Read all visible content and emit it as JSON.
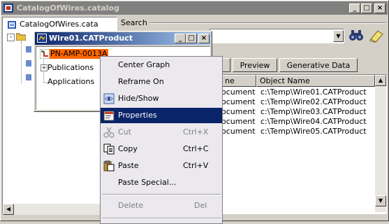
{
  "main_window": {
    "title": "CatalogOfWires.catalog"
  },
  "tree": {
    "root_label": "CatalogOfWires.cata"
  },
  "search": {
    "label": "Search"
  },
  "tabs": [
    {
      "label": "Preview"
    },
    {
      "label": "Generative Data"
    }
  ],
  "table": {
    "headers": {
      "type": "ne",
      "object_name": "Object Name"
    },
    "rows": [
      {
        "type": "ocument",
        "object_name": "c:\\Temp\\Wire01.CATProduct"
      },
      {
        "type": "ocument",
        "object_name": "c:\\Temp\\Wire02.CATProduct"
      },
      {
        "type": "ocument",
        "object_name": "c:\\Temp\\Wire03.CATProduct"
      },
      {
        "type": "ocument",
        "object_name": "c:\\Temp\\Wire04.CATProduct"
      },
      {
        "type": "ocument",
        "object_name": "c:\\Temp\\Wire05.CATProduct"
      }
    ]
  },
  "sub_window": {
    "title": "Wire01.CATProduct",
    "tree": {
      "part_label": "PN-AMP-0013A",
      "publications_label": "Publications",
      "applications_label": "Applications"
    }
  },
  "context_menu": {
    "center_graph": "Center Graph",
    "reframe_on": "Reframe On",
    "hide_show": "Hide/Show",
    "properties": "Properties",
    "cut": "Cut",
    "cut_shortcut": "Ctrl+X",
    "copy": "Copy",
    "copy_shortcut": "Ctrl+C",
    "paste": "Paste",
    "paste_shortcut": "Ctrl+V",
    "paste_special": "Paste Special...",
    "delete": "Delete",
    "delete_shortcut": "Del"
  },
  "colors": {
    "menu_selection": "#0a246a",
    "highlight_part": "#ff6600",
    "inactive_title": "#808080"
  }
}
